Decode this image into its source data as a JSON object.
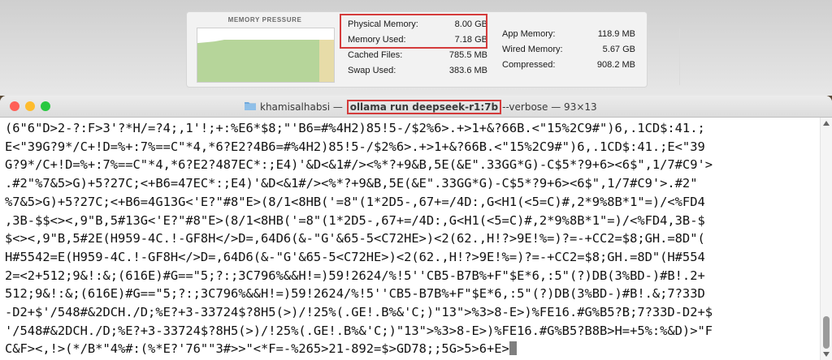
{
  "activity_monitor": {
    "pressure_title": "MEMORY PRESSURE",
    "left_stats": [
      {
        "label": "Physical Memory:",
        "value": "8.00 GB"
      },
      {
        "label": "Memory Used:",
        "value": "7.18 GB"
      },
      {
        "label": "Cached Files:",
        "value": "785.5 MB"
      },
      {
        "label": "Swap Used:",
        "value": "383.6 MB"
      }
    ],
    "right_stats": [
      {
        "label": "App Memory:",
        "value": "118.9 MB"
      },
      {
        "label": "Wired Memory:",
        "value": "5.67 GB"
      },
      {
        "label": "Compressed:",
        "value": "908.2 MB"
      }
    ]
  },
  "terminal": {
    "title_user": "khamisalhabsi",
    "title_dash": "—",
    "title_command": "ollama run deepseek-r1:7b",
    "title_rest": "--verbose — 93×13",
    "lines": [
      "(6\"6\"D>2-?:F>3'?*H/=?4;,1'!;+:%E6*$8;\"'B6=#%4H2)85!5-/$2%6>.+>1+&?66B.<\"15%2C9#\")6,.1CD$:41.;",
      "E<\"39G?9*/C+!D=%+:7%==C\"*4,*6?E2?4B6=#%4H2)85!5-/$2%6>.+>1+&?66B.<\"15%2C9#\")6,.1CD$:41.;E<\"39",
      "G?9*/C+!D=%+:7%==C\"*4,*6?E2?487EC*:;E4)'&D<&1#/><%*?+9&B,5E(&E\".33GG*G)-C$5*?9+6><6$\",1/7#C9'>",
      ".#2\"%7&5>G)+5?27C;<+B6=47EC*:;E4)'&D<&1#/><%*?+9&B,5E(&E\".33GG*G)-C$5*?9+6><6$\",1/7#C9'>.#2\"",
      "%7&5>G)+5?27C;<+B6=4G13G<'E?\"#8\"E>(8/1<8HB('=8\"(1*2D5-,67+=/4D:,G<H1(<5=C)#,2*9%8B*1\"=)/<%FD4",
      ",3B-$$<><,9\"B,5#13G<'E?\"#8\"E>(8/1<8HB('=8\"(1*2D5-,67+=/4D:,G<H1(<5=C)#,2*9%8B*1\"=)/<%FD4,3B-$",
      "$<><,9\"B,5#2E(H959-4C.!-GF8H</>D=,64D6(&-\"G'&65-5<C72HE>)<2(62.,H!?>9E!%=)?=-+CC2=$8;GH.=8D\"(",
      "H#5542=E(H959-4C.!-GF8H</>D=,64D6(&-\"G'&65-5<C72HE>)<2(62.,H!?>9E!%=)?=-+CC2=$8;GH.=8D\"(H#554",
      "2=<2+512;9&!:&;(616E)#G==\"5;?:;3C796%&&H!=)59!2624/%!5''CB5-B7B%+F\"$E*6,:5\"(?)DB(3%BD-)#B!.2+",
      "512;9&!:&;(616E)#G==\"5;?:;3C796%&&H!=)59!2624/%!5''CB5-B7B%+F\"$E*6,:5\"(?)DB(3%BD-)#B!.&;7?33D",
      "-D2+$'/548#&2DCH./D;%E?+3-33724$?8H5(>)/!25%(.GE!.B%&'C;)\"13\">%3>8-E>)%FE16.#G%B5?B;7?33D-D2+$",
      "'/548#&2DCH./D;%E?+3-33724$?8H5(>)/!25%(.GE!.B%&'C;)\"13\">%3>8-E>)%FE16.#G%B5?B8B>H=+5%:%&D)>\"F",
      "C&F><,!>(*/B*\"4%#:(%*E?'76\"\"3#>>\"<*F=-%265>21-892=$>GD78;;5G>5>6+E>"
    ]
  }
}
